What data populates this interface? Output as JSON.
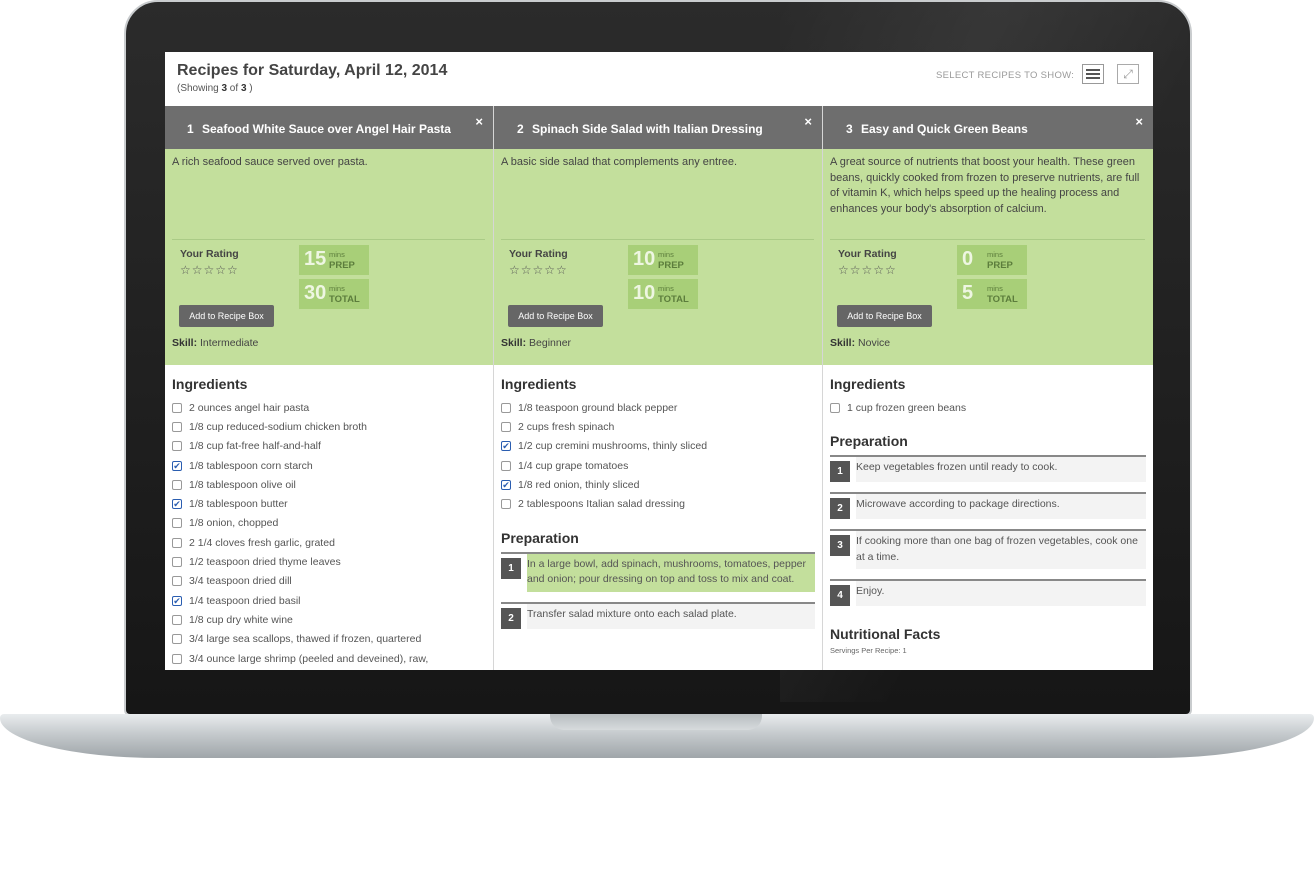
{
  "header": {
    "title": "Recipes for Saturday, April 12, 2014",
    "showing_prefix": "(Showing ",
    "showing_count": "3",
    "showing_of": " of ",
    "showing_total": "3",
    "showing_suffix": " )",
    "select_label": "SELECT RECIPES TO SHOW:",
    "list_icon": "list-icon",
    "expand_icon": "expand-icon"
  },
  "recipes": [
    {
      "number": "1",
      "name": "Seafood White Sauce over Angel Hair Pasta",
      "close": "×",
      "description": "A rich seafood sauce served over pasta.",
      "rating_label": "Your Rating",
      "stars": "☆☆☆☆☆",
      "prep_value": "15",
      "prep_unit": "mins",
      "prep_label": "PREP",
      "total_value": "30",
      "total_unit": "mins",
      "total_label": "TOTAL",
      "add_button": "Add to Recipe Box",
      "skill_label": "Skill:",
      "skill_value": "Intermediate",
      "ingredients_title": "Ingredients",
      "ingredients": [
        {
          "text": "2 ounces angel hair pasta",
          "checked": false
        },
        {
          "text": "1/8 cup reduced-sodium chicken broth",
          "checked": false
        },
        {
          "text": "1/8 cup fat-free half-and-half",
          "checked": false
        },
        {
          "text": "1/8 tablespoon corn starch",
          "checked": true
        },
        {
          "text": "1/8 tablespoon olive oil",
          "checked": false
        },
        {
          "text": "1/8 tablespoon butter",
          "checked": true
        },
        {
          "text": "1/8 onion, chopped",
          "checked": false
        },
        {
          "text": "2 1/4 cloves fresh garlic, grated",
          "checked": false
        },
        {
          "text": "1/2 teaspoon dried thyme leaves",
          "checked": false
        },
        {
          "text": "3/4 teaspoon dried dill",
          "checked": false
        },
        {
          "text": "1/4 teaspoon dried basil",
          "checked": true
        },
        {
          "text": "1/8 cup dry white wine",
          "checked": false
        },
        {
          "text": "3/4 large sea scallops, thawed if frozen, quartered",
          "checked": false
        },
        {
          "text": "3/4 ounce large shrimp (peeled and deveined), raw,",
          "checked": false
        }
      ]
    },
    {
      "number": "2",
      "name": "Spinach Side Salad with Italian Dressing",
      "close": "×",
      "description": "A basic side salad that complements any entree.",
      "rating_label": "Your Rating",
      "stars": "☆☆☆☆☆",
      "prep_value": "10",
      "prep_unit": "mins",
      "prep_label": "PREP",
      "total_value": "10",
      "total_unit": "mins",
      "total_label": "TOTAL",
      "add_button": "Add to Recipe Box",
      "skill_label": "Skill:",
      "skill_value": "Beginner",
      "ingredients_title": "Ingredients",
      "ingredients": [
        {
          "text": "1/8 teaspoon ground black pepper",
          "checked": false
        },
        {
          "text": "2 cups fresh spinach",
          "checked": false
        },
        {
          "text": "1/2 cup cremini mushrooms, thinly sliced",
          "checked": true
        },
        {
          "text": "1/4 cup grape tomatoes",
          "checked": false
        },
        {
          "text": "1/8 red onion, thinly sliced",
          "checked": true
        },
        {
          "text": "2 tablespoons Italian salad dressing",
          "checked": false
        }
      ],
      "preparation_title": "Preparation",
      "steps": [
        {
          "n": "1",
          "text": "In a large bowl, add spinach, mushrooms, tomatoes, pepper and onion; pour dressing on top and toss to mix and coat.",
          "highlight": true
        },
        {
          "n": "2",
          "text": "Transfer salad mixture onto each salad plate.",
          "highlight": false
        }
      ]
    },
    {
      "number": "3",
      "name": "Easy and Quick Green Beans",
      "close": "×",
      "description": "A great source of nutrients that boost your health. These green beans, quickly cooked from frozen to preserve nutrients, are full of vitamin K, which helps speed up the healing process and enhances your body's absorption of calcium.",
      "rating_label": "Your Rating",
      "stars": "☆☆☆☆☆",
      "prep_value": "0",
      "prep_unit": "mins",
      "prep_label": "PREP",
      "total_value": "5",
      "total_unit": "mins",
      "total_label": "TOTAL",
      "add_button": "Add to Recipe Box",
      "skill_label": "Skill:",
      "skill_value": "Novice",
      "ingredients_title": "Ingredients",
      "ingredients": [
        {
          "text": "1 cup frozen green beans",
          "checked": false
        }
      ],
      "preparation_title": "Preparation",
      "steps": [
        {
          "n": "1",
          "text": "Keep vegetables frozen until ready to cook.",
          "highlight": false
        },
        {
          "n": "2",
          "text": "Microwave according to package directions.",
          "highlight": false
        },
        {
          "n": "3",
          "text": "If cooking more than one bag of frozen vegetables, cook one at a time.",
          "highlight": false
        },
        {
          "n": "4",
          "text": "Enjoy.",
          "highlight": false
        }
      ],
      "nutrition_title": "Nutritional Facts",
      "servings": "Servings Per Recipe: 1"
    }
  ],
  "colors": {
    "header_bar": "#6e6e6e",
    "summary_green": "#c3df9c",
    "time_box_green": "#a8cf78",
    "button_gray": "#666666"
  }
}
